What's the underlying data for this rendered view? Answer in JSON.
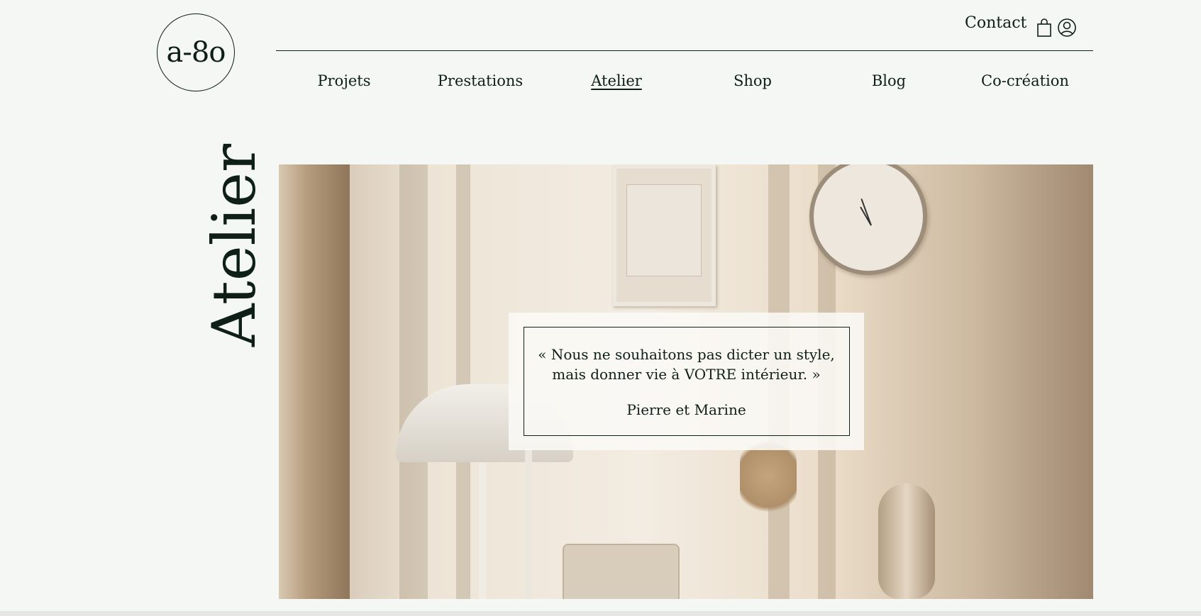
{
  "logo": {
    "text": "a-8o"
  },
  "header": {
    "contact_label": "Contact",
    "cart_icon": "shopping-bag-icon",
    "account_icon": "user-icon"
  },
  "nav": {
    "items": [
      {
        "label": "Projets"
      },
      {
        "label": "Prestations"
      },
      {
        "label": "Atelier",
        "active": true
      },
      {
        "label": "Shop"
      },
      {
        "label": "Blog"
      },
      {
        "label": "Co-création"
      }
    ]
  },
  "page": {
    "title": "Atelier"
  },
  "quote": {
    "line1": "« Nous ne souhaitons pas dicter un style,",
    "line2": "mais donner vie à VOTRE intérieur. »",
    "author": "Pierre et Marine"
  },
  "colors": {
    "text": "#0d1f17",
    "background": "#f5f7f4"
  }
}
